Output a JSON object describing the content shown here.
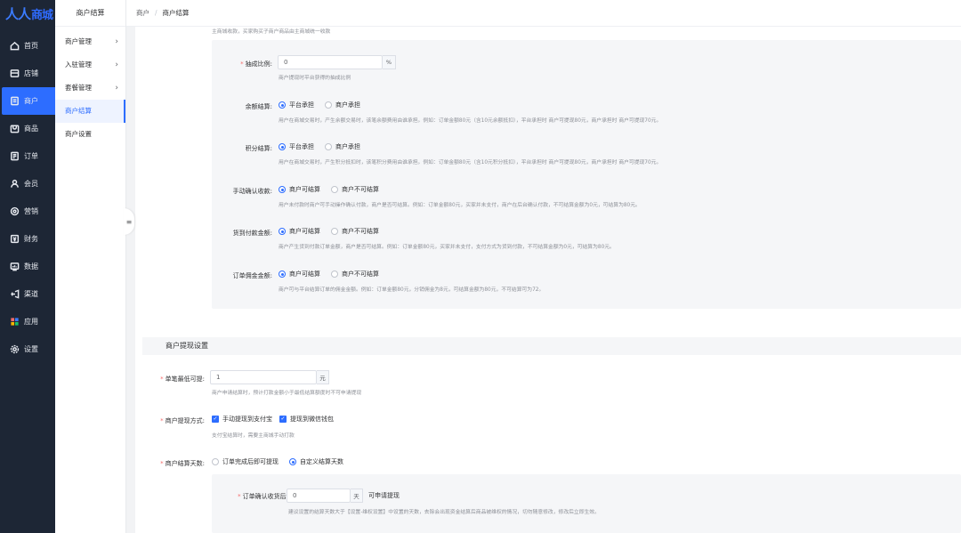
{
  "brand": {
    "logo_mark": "人人",
    "logo_text": "商城"
  },
  "nav": {
    "items": [
      {
        "label": "首页",
        "icon": "home-icon"
      },
      {
        "label": "店铺",
        "icon": "store-icon"
      },
      {
        "label": "商户",
        "icon": "merchant-icon"
      },
      {
        "label": "商品",
        "icon": "product-icon"
      },
      {
        "label": "订单",
        "icon": "order-icon"
      },
      {
        "label": "会员",
        "icon": "member-icon"
      },
      {
        "label": "营销",
        "icon": "marketing-icon"
      },
      {
        "label": "财务",
        "icon": "finance-icon"
      },
      {
        "label": "数据",
        "icon": "data-icon"
      },
      {
        "label": "渠道",
        "icon": "channel-icon"
      },
      {
        "label": "应用",
        "icon": "apps-icon"
      },
      {
        "label": "设置",
        "icon": "gear-icon"
      }
    ],
    "active_index": 2
  },
  "subnav": {
    "title": "商户结算",
    "items": [
      {
        "label": "商户管理",
        "chevron": "›"
      },
      {
        "label": "入驻管理",
        "chevron": "›"
      },
      {
        "label": "套餐管理",
        "chevron": "›"
      },
      {
        "label": "商户结算",
        "chevron": ""
      },
      {
        "label": "商户设置",
        "chevron": ""
      }
    ],
    "collapse_glyph": "≡"
  },
  "breadcrumb": {
    "root": "商户",
    "sep": "/",
    "current": "商户结算"
  },
  "top_hint": "主商城收款，买家购买子商户商品由主商城统一收款",
  "commission": {
    "label": "抽成比例:",
    "value": "0",
    "suffix": "%",
    "hint": "商户提现时平台获得的抽成比例"
  },
  "balance": {
    "label": "余额结算:",
    "options": [
      "平台承担",
      "商户承担"
    ],
    "selected": 0,
    "hint": "用户在商城交易时，产生余额交易时，该笔余额费用由谁承担。例如：订单金额80元（含10元余额抵扣），平台承担时 商户可提现80元，商户承担时 商户可提现70元。"
  },
  "points": {
    "label": "积分结算:",
    "options": [
      "平台承担",
      "商户承担"
    ],
    "selected": 0,
    "hint": "用户在商城交易时，产生积分抵扣时，该笔积分费用由谁承担。例如：订单金额80元（含10元积分抵扣），平台承担时 商户可提现80元，商户承担时 商户可提现70元。"
  },
  "manual_confirm": {
    "label": "手动确认收款:",
    "options": [
      "商户可结算",
      "商户不可结算"
    ],
    "selected": 0,
    "hint": "用户未付款时商户可手动操作确认付款，商户是否可结算。例如：订单金额80元，买家并未支付，商户在后台确认付款，不可结算金额为0元，可结算为80元。"
  },
  "cod": {
    "label": "货到付款金额:",
    "options": [
      "商户可结算",
      "商户不可结算"
    ],
    "selected": 0,
    "hint": "商户产生货到付款订单金额，商户是否可结算。例如：订单金额80元，买家并未支付，支付方式为货到付款，不可结算金额为0元，可结算为80元。"
  },
  "commission_order": {
    "label": "订单佣金金额:",
    "options": [
      "商户可结算",
      "商户不可结算"
    ],
    "selected": 0,
    "hint": "商户可与平台结算订单的佣金金额。例如：订单金额80元，分销佣金为8元，可结算金额为80元，不可结算可为72。"
  },
  "withdraw_section": {
    "title": "商户提现设置"
  },
  "min_withdraw": {
    "label": "单笔最低可提:",
    "value": "1",
    "suffix": "元",
    "hint": "商户申请结算时，预计打款金额小于最低结算额度时不可申请提现"
  },
  "withdraw_method": {
    "label": "商户提现方式:",
    "options": [
      "手动提现到支付宝",
      "提现到微信钱包"
    ],
    "check_glyph": "✓",
    "hint": "支付宝结算时，需要主商城手动打款"
  },
  "settle_days": {
    "label": "商户结算天数:",
    "options": [
      "订单完成后即可提现",
      "自定义结算天数"
    ],
    "selected": 1
  },
  "confirm_days": {
    "label": "订单确认收货后:",
    "value": "0",
    "suffix": "天",
    "after": "可申请提现",
    "hint": "建议设置的结算天数大于【设置-维权设置】中设置的天数，去除会出现资金结算后商品被维权的情况，切勿随意修改，修改后立即生效。"
  },
  "required_mark": "*"
}
